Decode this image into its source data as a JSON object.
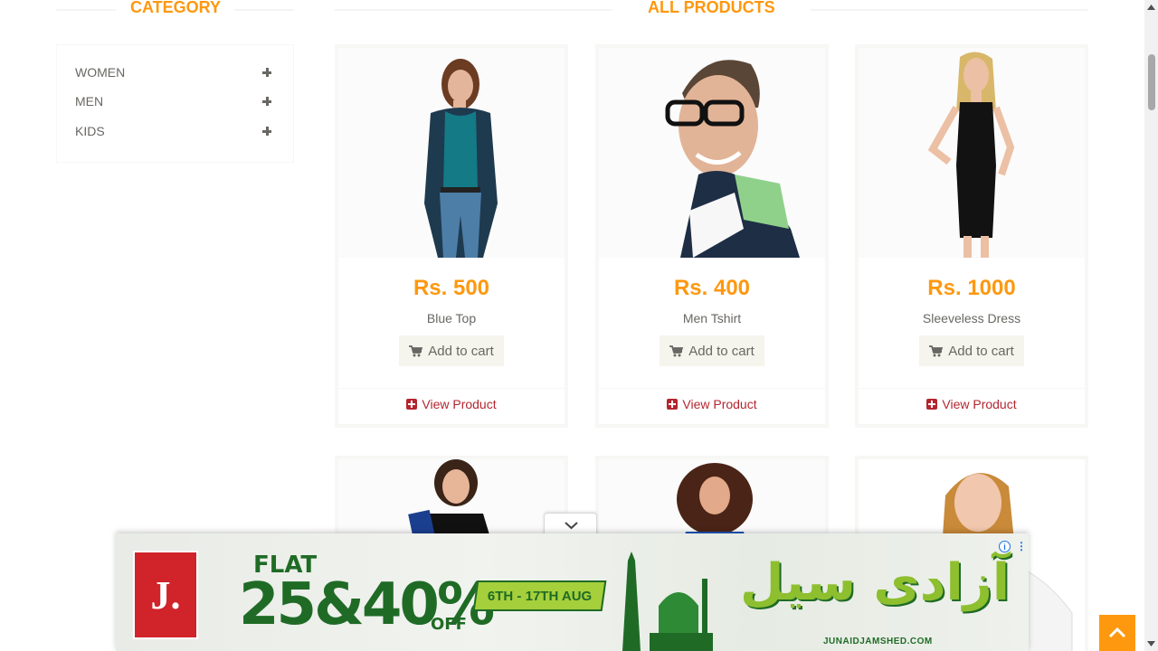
{
  "headings": {
    "category": "CATEGORY",
    "all_products": "ALL PRODUCTS"
  },
  "categories": [
    {
      "label": "WOMEN",
      "icon": "plus-icon"
    },
    {
      "label": "MEN",
      "icon": "plus-icon"
    },
    {
      "label": "KIDS",
      "icon": "plus-icon"
    }
  ],
  "products": [
    {
      "price": "Rs. 500",
      "name": "Blue Top",
      "cart_label": "Add to cart",
      "view_label": "View Product"
    },
    {
      "price": "Rs. 400",
      "name": "Men Tshirt",
      "cart_label": "Add to cart",
      "view_label": "View Product"
    },
    {
      "price": "Rs. 1000",
      "name": "Sleeveless Dress",
      "cart_label": "Add to cart",
      "view_label": "View Product"
    }
  ],
  "ad": {
    "flat": "FLAT",
    "discount": "25&40%",
    "off": "OFF",
    "dates": "6TH - 17TH AUG",
    "urdu_title": "آزادی سیل",
    "site": "JUNAIDJAMSHED.COM",
    "logo": "J.",
    "info_icon": "info-icon",
    "more_icon": "more-vertical-icon"
  },
  "colors": {
    "accent": "#fe980f",
    "view_link": "#b4252f",
    "text": "#696763",
    "button_bg": "#f5f5ed"
  }
}
